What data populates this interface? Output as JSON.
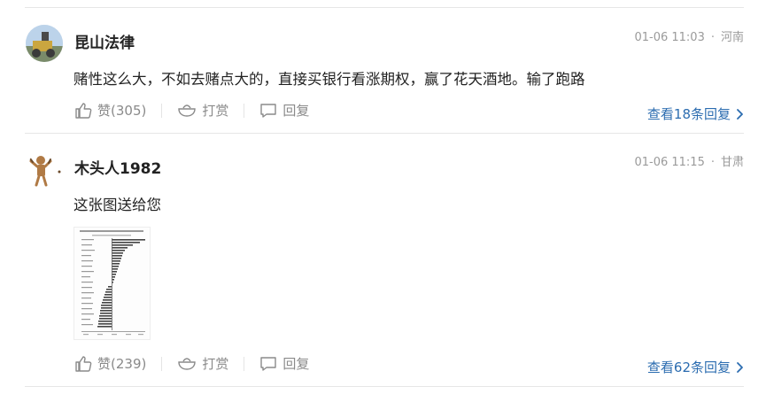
{
  "comments": [
    {
      "username": "昆山法律",
      "time": "01-06 11:03",
      "separator": "·",
      "location": "河南",
      "text": "赌性这么大，不如去赌点大的，直接买银行看涨期权，赢了花天酒地。输了跑路",
      "like_label": "赞(305)",
      "tip_label": "打赏",
      "reply_label": "回复",
      "view_replies": "查看18条回复"
    },
    {
      "username": "木头人1982",
      "time": "01-06 11:15",
      "separator": "·",
      "location": "甘肃",
      "text": "这张图送给您",
      "like_label": "赞(239)",
      "tip_label": "打赏",
      "reply_label": "回复",
      "view_replies": "查看62条回复"
    }
  ],
  "colors": {
    "link": "#2b6cb0",
    "muted": "#8a8a8a",
    "divider": "#e6e6e6"
  },
  "icons": {
    "like": "thumbs-up-icon",
    "tip": "tip-bowl-icon",
    "reply": "speech-bubble-icon",
    "more": "chevron-right-icon"
  }
}
